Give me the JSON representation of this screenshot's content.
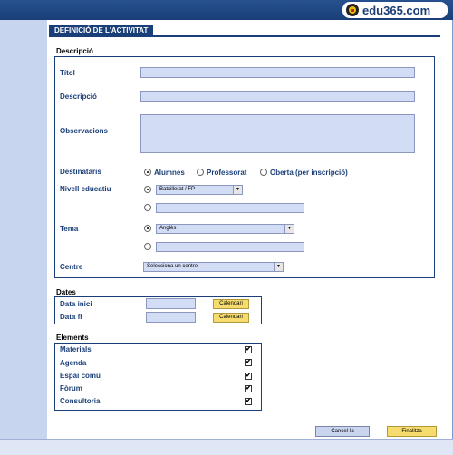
{
  "brand": {
    "logo_text": "edu365.com"
  },
  "tab_title": "DEFINICIÓ DE L'ACTIVITAT",
  "descripcio_section": {
    "title": "Descripció",
    "titol_label": "Títol",
    "descripcio_label": "Descripció",
    "observacions_label": "Observacions",
    "destinataris_label": "Destinataris",
    "destinataris_options": [
      "Alumnes",
      "Professorat",
      "Oberta (per inscripció)"
    ],
    "nivell_label": "Nivell educatiu",
    "nivell_selected": "Batxillerat / FP",
    "tema_label": "Tema",
    "tema_selected": "Anglès",
    "centre_label": "Centre",
    "centre_selected": "Selecciona un centre"
  },
  "dates_section": {
    "title": "Dates",
    "data_inici_label": "Data inici",
    "data_fi_label": "Data fi",
    "calendar_button": "Calendari"
  },
  "elements_section": {
    "title": "Elements",
    "items": [
      {
        "label": "Materials",
        "checked": true
      },
      {
        "label": "Agenda",
        "checked": true
      },
      {
        "label": "Espai comú",
        "checked": true
      },
      {
        "label": "Fòrum",
        "checked": true
      },
      {
        "label": "Consultoria",
        "checked": true
      }
    ],
    "check_glyph": "✔"
  },
  "buttons": {
    "cancel": "Cancel·la",
    "finish": "Finalitza"
  },
  "colors": {
    "navy": "#1a3f78",
    "input_bg": "#d2dcf4",
    "button_yellow": "#f6dc6e"
  }
}
